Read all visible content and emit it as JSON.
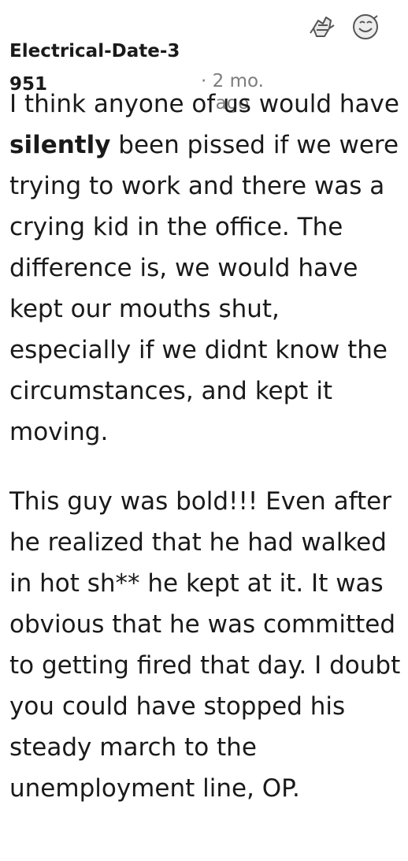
{
  "comment": {
    "author": "Electrical-Date-3951",
    "time_sep": "·",
    "time_ago": "2 mo. ago",
    "awards": [
      "award-hands-icon",
      "award-face-icon"
    ],
    "paragraph1": {
      "before": "I think anyone of us would have ",
      "bold": "silently",
      "after": " been pissed if we were trying to work and there was a crying kid in the office. The difference is, we would have kept our mouths shut, especially if we didnt know the circumstances, and kept it moving."
    },
    "paragraph2": "This guy was bold!!! Even after he realized that he had walked in hot sh** he kept at it. It was obvious that he was committed to getting fired that day. I doubt you could have stopped his steady march to the unemployment line, OP."
  }
}
